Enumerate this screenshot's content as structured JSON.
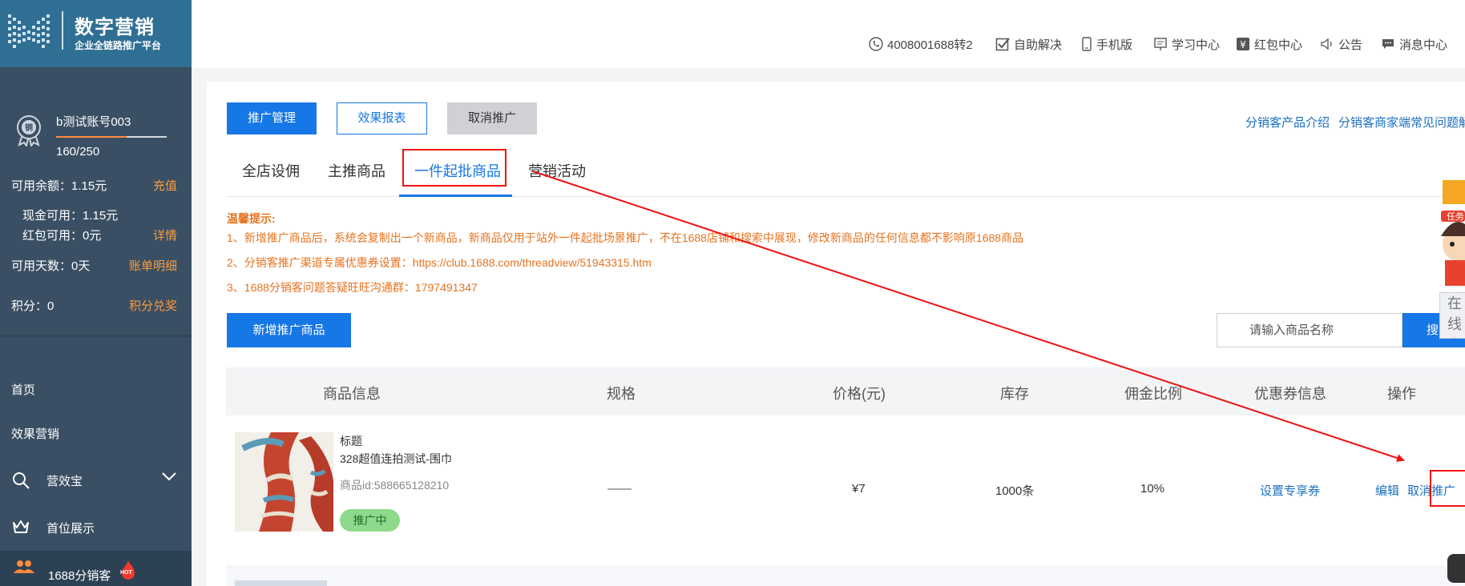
{
  "brand": {
    "title": "数字营销",
    "subtitle": "企业全链路推广平台"
  },
  "account": {
    "name": "b测试账号003",
    "progress_text": "160/250",
    "progress_fraction": 0.64
  },
  "balances": {
    "available_label": "可用余额：1.15元",
    "recharge_link": "充值",
    "cash_label": "现金可用：1.15元",
    "redpacket_label": "红包可用：0元",
    "detail_link": "详情",
    "days_label": "可用天数：0天",
    "bill_link": "账单明细",
    "points_label": "积分：0",
    "points_link": "积分兑奖"
  },
  "nav": {
    "home": "首页",
    "effect": "效果营销",
    "yingxiaobao": "营效宝",
    "top_display": "首位展示",
    "distributor": "1688分销客",
    "hot_badge": "HOT"
  },
  "topbar": {
    "phone": "4008001688转2",
    "self_service": "自助解决",
    "mobile": "手机版",
    "learning": "学习中心",
    "redpacket_center": "红包中心",
    "notice": "公告",
    "messages": "消息中心"
  },
  "actions": {
    "promo_manage": "推广管理",
    "effect_report": "效果报表",
    "cancel_promo": "取消推广",
    "intro_link": "分销客产品介绍",
    "faq_link": "分销客商家端常见问题解"
  },
  "tabs": [
    "全店设佣",
    "主推商品",
    "一件起批商品",
    "营销活动"
  ],
  "tips": {
    "title": "温馨提示:",
    "items": [
      "1、新增推广商品后，系统会复制出一个新商品，新商品仅用于站外一件起批场景推广，不在1688店铺和搜索中展现，修改新商品的任何信息都不影响原1688商品",
      "2、分销客推广渠道专属优惠券设置：https://club.1688.com/threadview/51943315.htm",
      "3、1688分销客问题答疑旺旺沟通群：1797491347"
    ]
  },
  "toolbar": {
    "add_product": "新增推广商品",
    "search_placeholder": "请输入商品名称",
    "search_button": "搜"
  },
  "table": {
    "headers": [
      "商品信息",
      "规格",
      "价格(元)",
      "库存",
      "佣金比例",
      "优惠券信息",
      "操作"
    ],
    "row": {
      "title_label": "标题",
      "title": "328超值连拍测试-围巾",
      "product_id": "商品id:588665128210",
      "status": "推广中",
      "spec": "——",
      "price": "¥7",
      "stock": "1000条",
      "commission": "10%",
      "coupon_link": "设置专享券",
      "edit_link": "编辑",
      "cancel_link": "取消推广"
    }
  },
  "widgets": {
    "mascot_banner": "任务",
    "consult_text": "在线咨询"
  },
  "colors": {
    "sidebar": "#3a4f63",
    "logo_bg": "#2f6f93",
    "primary": "#1677e6",
    "tip_orange": "#e6731f",
    "highlight_red": "#e11111"
  }
}
